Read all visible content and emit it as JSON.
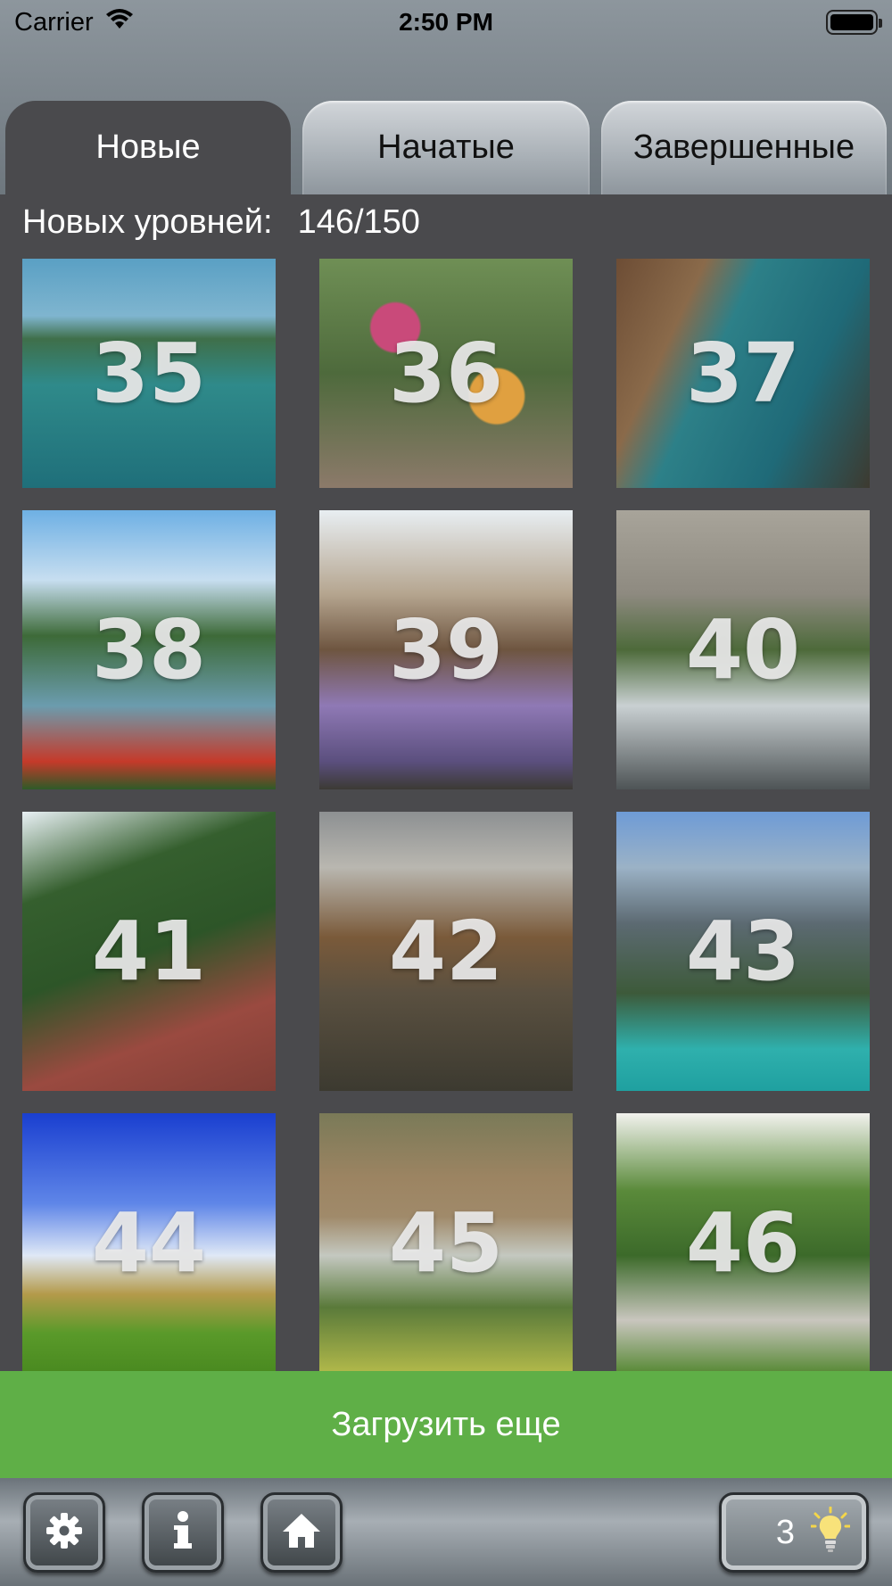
{
  "status_bar": {
    "carrier": "Carrier",
    "time": "2:50 PM"
  },
  "tabs": [
    {
      "label": "Новые",
      "active": true
    },
    {
      "label": "Начатые",
      "active": false
    },
    {
      "label": "Завершенные",
      "active": false
    }
  ],
  "levels_info": {
    "label": "Новых уровней:",
    "value": "146/150"
  },
  "levels": [
    {
      "number": "35"
    },
    {
      "number": "36"
    },
    {
      "number": "37"
    },
    {
      "number": "38"
    },
    {
      "number": "39"
    },
    {
      "number": "40"
    },
    {
      "number": "41"
    },
    {
      "number": "42"
    },
    {
      "number": "43"
    },
    {
      "number": "44"
    },
    {
      "number": "45"
    },
    {
      "number": "46"
    }
  ],
  "load_more_label": "Загрузить еще",
  "bottom_bar": {
    "buttons": [
      "gear-icon",
      "info-icon",
      "home-icon"
    ],
    "hints_count": "3",
    "hint_icon": "lightbulb-icon"
  },
  "colors": {
    "background": "#4a4a4d",
    "load_more": "#5faf47",
    "active_tab": "#4a4a4d"
  }
}
